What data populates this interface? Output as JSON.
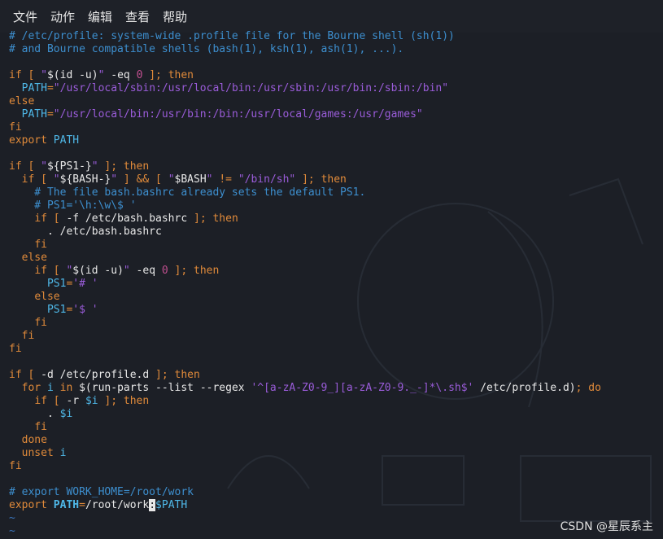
{
  "menu": {
    "items": [
      "文件",
      "动作",
      "编辑",
      "查看",
      "帮助"
    ]
  },
  "editor": {
    "lines": [
      "# /etc/profile: system-wide .profile file for the Bourne shell (sh(1))",
      "# and Bourne compatible shells (bash(1), ksh(1), ash(1), ...).",
      "",
      "if [ \"$(id -u)\" -eq 0 ]; then",
      "  PATH=\"/usr/local/sbin:/usr/local/bin:/usr/sbin:/usr/bin:/sbin:/bin\"",
      "else",
      "  PATH=\"/usr/local/bin:/usr/bin:/bin:/usr/local/games:/usr/games\"",
      "fi",
      "export PATH",
      "",
      "if [ \"${PS1-}\" ]; then",
      "  if [ \"${BASH-}\" ] && [ \"$BASH\" != \"/bin/sh\" ]; then",
      "    # The file bash.bashrc already sets the default PS1.",
      "    # PS1='\\h:\\w\\$ '",
      "    if [ -f /etc/bash.bashrc ]; then",
      "      . /etc/bash.bashrc",
      "    fi",
      "  else",
      "    if [ \"$(id -u)\" -eq 0 ]; then",
      "      PS1='# '",
      "    else",
      "      PS1='$ '",
      "    fi",
      "  fi",
      "fi",
      "",
      "if [ -d /etc/profile.d ]; then",
      "  for i in $(run-parts --list --regex '^[a-zA-Z0-9_][a-zA-Z0-9._-]*\\.sh$' /etc/profile.d); do",
      "    if [ -r $i ]; then",
      "      . $i",
      "    fi",
      "  done",
      "  unset i",
      "fi",
      "",
      "# export WORK_HOME=/root/work",
      "export PATH=/root/work:$PATH",
      "~",
      "~"
    ]
  },
  "watermark": "CSDN @星辰系主"
}
